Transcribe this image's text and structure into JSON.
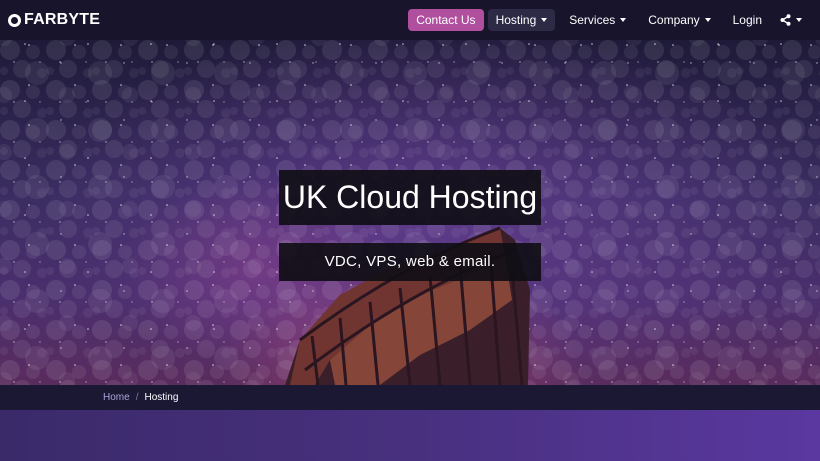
{
  "brand": {
    "name": "FARBYTE"
  },
  "nav": {
    "contact": "Contact Us",
    "hosting": "Hosting",
    "services": "Services",
    "company": "Company",
    "login": "Login",
    "share_icon": "share-icon"
  },
  "hero": {
    "title": "UK Cloud Hosting",
    "subtitle": "VDC, VPS, web & email."
  },
  "breadcrumb": {
    "home": "Home",
    "separator": "/",
    "current": "Hosting"
  },
  "colors": {
    "navbar_bg": "#17142b",
    "contact_button": "#b04f9e",
    "active_nav": "#2d2a45",
    "breadcrumb_link": "#a9a3d8"
  }
}
